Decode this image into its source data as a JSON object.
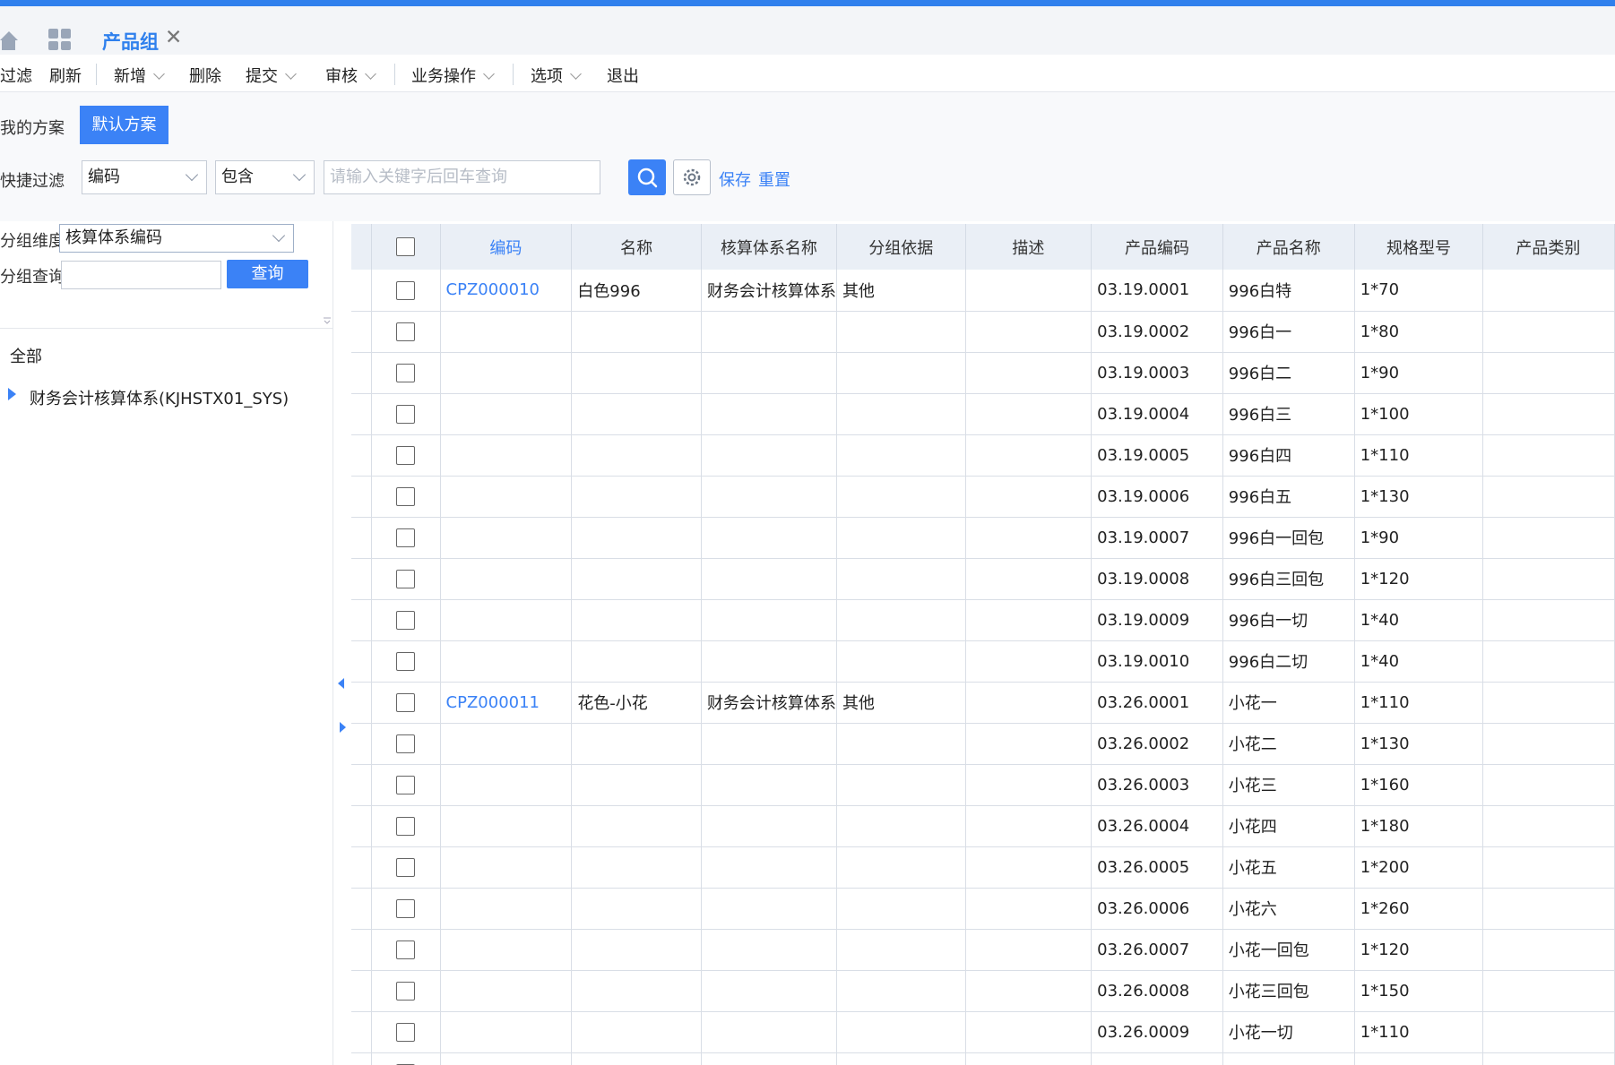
{
  "tabs": {
    "active_label": "产品组",
    "close_icon": "✕"
  },
  "toolbar": {
    "items": [
      "过滤",
      "刷新",
      "新增",
      "删除",
      "提交",
      "审核",
      "业务操作",
      "选项",
      "退出"
    ]
  },
  "scheme": {
    "label": "我的方案",
    "default_button": "默认方案"
  },
  "quick_filter": {
    "label": "快捷过滤",
    "field_value": "编码",
    "op_value": "包含",
    "keyword_placeholder": "请输入关键字后回车查询",
    "save_link": "保存",
    "reset_link": "重置"
  },
  "left": {
    "dimension_label": "分组维度",
    "dimension_value": "核算体系编码",
    "query_label": "分组查询",
    "query_value": "",
    "query_button": "查询",
    "tree_all": "全部",
    "tree_node": "财务会计核算体系(KJHSTX01_SYS)"
  },
  "grid": {
    "columns": [
      "编码",
      "名称",
      "核算体系名称",
      "分组依据",
      "描述",
      "产品编码",
      "产品名称",
      "规格型号",
      "产品类别"
    ],
    "rows": [
      {
        "code": "CPZ000010",
        "name": "白色996",
        "sys": "财务会计核算体系",
        "basis": "其他",
        "desc": "",
        "pcode": "03.19.0001",
        "pname": "996白特",
        "spec": "1*70"
      },
      {
        "code": "",
        "name": "",
        "sys": "",
        "basis": "",
        "desc": "",
        "pcode": "03.19.0002",
        "pname": "996白一",
        "spec": "1*80"
      },
      {
        "code": "",
        "name": "",
        "sys": "",
        "basis": "",
        "desc": "",
        "pcode": "03.19.0003",
        "pname": "996白二",
        "spec": "1*90"
      },
      {
        "code": "",
        "name": "",
        "sys": "",
        "basis": "",
        "desc": "",
        "pcode": "03.19.0004",
        "pname": "996白三",
        "spec": "1*100"
      },
      {
        "code": "",
        "name": "",
        "sys": "",
        "basis": "",
        "desc": "",
        "pcode": "03.19.0005",
        "pname": "996白四",
        "spec": "1*110"
      },
      {
        "code": "",
        "name": "",
        "sys": "",
        "basis": "",
        "desc": "",
        "pcode": "03.19.0006",
        "pname": "996白五",
        "spec": "1*130"
      },
      {
        "code": "",
        "name": "",
        "sys": "",
        "basis": "",
        "desc": "",
        "pcode": "03.19.0007",
        "pname": "996白一回包",
        "spec": "1*90"
      },
      {
        "code": "",
        "name": "",
        "sys": "",
        "basis": "",
        "desc": "",
        "pcode": "03.19.0008",
        "pname": "996白三回包",
        "spec": "1*120"
      },
      {
        "code": "",
        "name": "",
        "sys": "",
        "basis": "",
        "desc": "",
        "pcode": "03.19.0009",
        "pname": "996白一切",
        "spec": "1*40"
      },
      {
        "code": "",
        "name": "",
        "sys": "",
        "basis": "",
        "desc": "",
        "pcode": "03.19.0010",
        "pname": "996白二切",
        "spec": "1*40"
      },
      {
        "code": "CPZ000011",
        "name": "花色-小花",
        "sys": "财务会计核算体系",
        "basis": "其他",
        "desc": "",
        "pcode": "03.26.0001",
        "pname": "小花一",
        "spec": "1*110"
      },
      {
        "code": "",
        "name": "",
        "sys": "",
        "basis": "",
        "desc": "",
        "pcode": "03.26.0002",
        "pname": "小花二",
        "spec": "1*130"
      },
      {
        "code": "",
        "name": "",
        "sys": "",
        "basis": "",
        "desc": "",
        "pcode": "03.26.0003",
        "pname": "小花三",
        "spec": "1*160"
      },
      {
        "code": "",
        "name": "",
        "sys": "",
        "basis": "",
        "desc": "",
        "pcode": "03.26.0004",
        "pname": "小花四",
        "spec": "1*180"
      },
      {
        "code": "",
        "name": "",
        "sys": "",
        "basis": "",
        "desc": "",
        "pcode": "03.26.0005",
        "pname": "小花五",
        "spec": "1*200"
      },
      {
        "code": "",
        "name": "",
        "sys": "",
        "basis": "",
        "desc": "",
        "pcode": "03.26.0006",
        "pname": "小花六",
        "spec": "1*260"
      },
      {
        "code": "",
        "name": "",
        "sys": "",
        "basis": "",
        "desc": "",
        "pcode": "03.26.0007",
        "pname": "小花一回包",
        "spec": "1*120"
      },
      {
        "code": "",
        "name": "",
        "sys": "",
        "basis": "",
        "desc": "",
        "pcode": "03.26.0008",
        "pname": "小花三回包",
        "spec": "1*150"
      },
      {
        "code": "",
        "name": "",
        "sys": "",
        "basis": "",
        "desc": "",
        "pcode": "03.26.0009",
        "pname": "小花一切",
        "spec": "1*110"
      },
      {
        "code": "",
        "name": "",
        "sys": "",
        "basis": "",
        "desc": "",
        "pcode": "",
        "pname": "",
        "spec": ""
      }
    ]
  },
  "colors": {
    "accent": "#3b82f6",
    "header_bg": "#eaeff6"
  }
}
